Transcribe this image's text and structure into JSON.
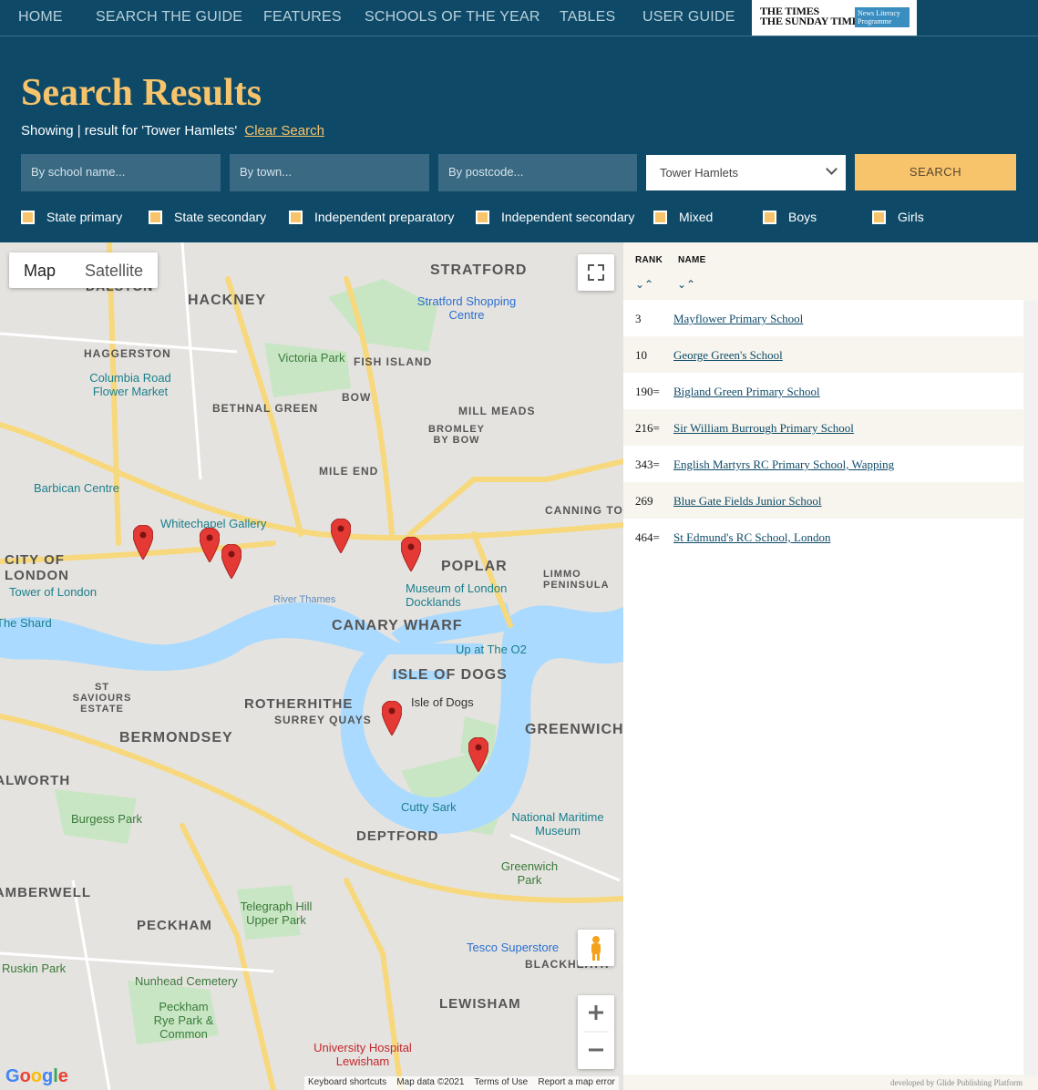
{
  "nav": {
    "items": [
      "HOME",
      "SEARCH THE GUIDE",
      "FEATURES",
      "SCHOOLS OF THE YEAR",
      "TABLES",
      "USER GUIDE"
    ],
    "logo_line1": "THE TIMES",
    "logo_line2": "THE SUNDAY TIMES",
    "logo_badge": "News Literacy Programme"
  },
  "header": {
    "title": "Search Results",
    "showing": "Showing | result for 'Tower Hamlets'",
    "clear_link": "Clear Search"
  },
  "search": {
    "name_placeholder": "By school name...",
    "town_placeholder": "By town...",
    "postcode_placeholder": "By postcode...",
    "area_selected": "Tower Hamlets",
    "button": "SEARCH"
  },
  "filters": [
    "State primary",
    "State secondary",
    "Independent preparatory",
    "Independent secondary",
    "Mixed",
    "Boys",
    "Girls"
  ],
  "map": {
    "type_map": "Map",
    "type_satellite": "Satellite",
    "district_labels": [
      "DALSTON",
      "HACKNEY",
      "STRATFORD",
      "HAGGERSTON",
      "BETHNAL GREEN",
      "BOW",
      "MILE END",
      "BROMLEY BY BOW",
      "CITY OF LONDON",
      "POPLAR",
      "LIMMO PENINSULA",
      "CANARY WHARF",
      "ISLE OF DOGS",
      "ROTHERHITHE",
      "SURREY QUAYS",
      "BERMONDSEY",
      "ST SAVIOURS ESTATE",
      "GREENWICH",
      "DEPTFORD",
      "PECKHAM",
      "LEWISHAM",
      "CANNING TOWN",
      "FISH ISLAND",
      "MILL MEADS",
      "CAMBERWELL",
      "WALWORTH",
      "BLACKHEATH"
    ],
    "poi_labels": [
      "Victoria Park",
      "Columbia Road Flower Market",
      "Barbican Centre",
      "Whitechapel Gallery",
      "Tower of London",
      "Museum of London Docklands",
      "Up at The O2",
      "Isle of Dogs",
      "Cutty Sark",
      "National Maritime Museum",
      "Burgess Park",
      "Greenwich Park",
      "Telegraph Hill Upper Park",
      "Nunhead Cemetery",
      "Peckham Rye Park & Common",
      "Tesco Superstore",
      "Stratford Shopping Centre",
      "River Thames",
      "The Shard",
      "Ruskin Park"
    ],
    "hospital_label": "University Hospital Lewisham",
    "attribution": [
      "Keyboard shortcuts",
      "Map data ©2021",
      "Terms of Use",
      "Report a map error"
    ],
    "google": "Google"
  },
  "results": {
    "col_rank": "RANK",
    "col_name": "NAME",
    "rows": [
      {
        "rank": "3",
        "name": "Mayflower Primary School"
      },
      {
        "rank": "10",
        "name": "George Green's School"
      },
      {
        "rank": "190=",
        "name": "Bigland Green Primary School"
      },
      {
        "rank": "216=",
        "name": "Sir William Burrough Primary School"
      },
      {
        "rank": "343=",
        "name": "English Martyrs RC Primary School, Wapping"
      },
      {
        "rank": "269",
        "name": "Blue Gate Fields Junior School"
      },
      {
        "rank": "464=",
        "name": "St Edmund's RC School, London"
      }
    ]
  },
  "footer": {
    "credit": "developed by Glide Publishing Platform"
  }
}
